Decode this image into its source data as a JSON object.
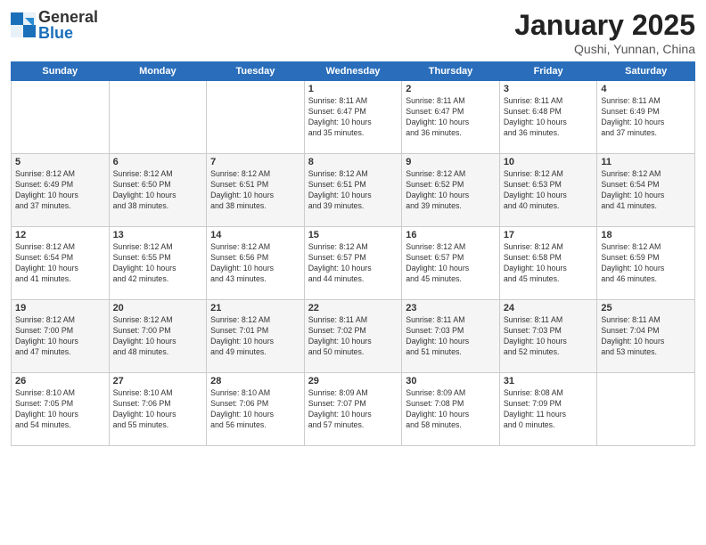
{
  "header": {
    "logo": {
      "general": "General",
      "blue": "Blue"
    },
    "title": "January 2025",
    "subtitle": "Qushi, Yunnan, China"
  },
  "days_of_week": [
    "Sunday",
    "Monday",
    "Tuesday",
    "Wednesday",
    "Thursday",
    "Friday",
    "Saturday"
  ],
  "weeks": [
    [
      {
        "day": "",
        "info": ""
      },
      {
        "day": "",
        "info": ""
      },
      {
        "day": "",
        "info": ""
      },
      {
        "day": "1",
        "info": "Sunrise: 8:11 AM\nSunset: 6:47 PM\nDaylight: 10 hours\nand 35 minutes."
      },
      {
        "day": "2",
        "info": "Sunrise: 8:11 AM\nSunset: 6:47 PM\nDaylight: 10 hours\nand 36 minutes."
      },
      {
        "day": "3",
        "info": "Sunrise: 8:11 AM\nSunset: 6:48 PM\nDaylight: 10 hours\nand 36 minutes."
      },
      {
        "day": "4",
        "info": "Sunrise: 8:11 AM\nSunset: 6:49 PM\nDaylight: 10 hours\nand 37 minutes."
      }
    ],
    [
      {
        "day": "5",
        "info": "Sunrise: 8:12 AM\nSunset: 6:49 PM\nDaylight: 10 hours\nand 37 minutes."
      },
      {
        "day": "6",
        "info": "Sunrise: 8:12 AM\nSunset: 6:50 PM\nDaylight: 10 hours\nand 38 minutes."
      },
      {
        "day": "7",
        "info": "Sunrise: 8:12 AM\nSunset: 6:51 PM\nDaylight: 10 hours\nand 38 minutes."
      },
      {
        "day": "8",
        "info": "Sunrise: 8:12 AM\nSunset: 6:51 PM\nDaylight: 10 hours\nand 39 minutes."
      },
      {
        "day": "9",
        "info": "Sunrise: 8:12 AM\nSunset: 6:52 PM\nDaylight: 10 hours\nand 39 minutes."
      },
      {
        "day": "10",
        "info": "Sunrise: 8:12 AM\nSunset: 6:53 PM\nDaylight: 10 hours\nand 40 minutes."
      },
      {
        "day": "11",
        "info": "Sunrise: 8:12 AM\nSunset: 6:54 PM\nDaylight: 10 hours\nand 41 minutes."
      }
    ],
    [
      {
        "day": "12",
        "info": "Sunrise: 8:12 AM\nSunset: 6:54 PM\nDaylight: 10 hours\nand 41 minutes."
      },
      {
        "day": "13",
        "info": "Sunrise: 8:12 AM\nSunset: 6:55 PM\nDaylight: 10 hours\nand 42 minutes."
      },
      {
        "day": "14",
        "info": "Sunrise: 8:12 AM\nSunset: 6:56 PM\nDaylight: 10 hours\nand 43 minutes."
      },
      {
        "day": "15",
        "info": "Sunrise: 8:12 AM\nSunset: 6:57 PM\nDaylight: 10 hours\nand 44 minutes."
      },
      {
        "day": "16",
        "info": "Sunrise: 8:12 AM\nSunset: 6:57 PM\nDaylight: 10 hours\nand 45 minutes."
      },
      {
        "day": "17",
        "info": "Sunrise: 8:12 AM\nSunset: 6:58 PM\nDaylight: 10 hours\nand 45 minutes."
      },
      {
        "day": "18",
        "info": "Sunrise: 8:12 AM\nSunset: 6:59 PM\nDaylight: 10 hours\nand 46 minutes."
      }
    ],
    [
      {
        "day": "19",
        "info": "Sunrise: 8:12 AM\nSunset: 7:00 PM\nDaylight: 10 hours\nand 47 minutes."
      },
      {
        "day": "20",
        "info": "Sunrise: 8:12 AM\nSunset: 7:00 PM\nDaylight: 10 hours\nand 48 minutes."
      },
      {
        "day": "21",
        "info": "Sunrise: 8:12 AM\nSunset: 7:01 PM\nDaylight: 10 hours\nand 49 minutes."
      },
      {
        "day": "22",
        "info": "Sunrise: 8:11 AM\nSunset: 7:02 PM\nDaylight: 10 hours\nand 50 minutes."
      },
      {
        "day": "23",
        "info": "Sunrise: 8:11 AM\nSunset: 7:03 PM\nDaylight: 10 hours\nand 51 minutes."
      },
      {
        "day": "24",
        "info": "Sunrise: 8:11 AM\nSunset: 7:03 PM\nDaylight: 10 hours\nand 52 minutes."
      },
      {
        "day": "25",
        "info": "Sunrise: 8:11 AM\nSunset: 7:04 PM\nDaylight: 10 hours\nand 53 minutes."
      }
    ],
    [
      {
        "day": "26",
        "info": "Sunrise: 8:10 AM\nSunset: 7:05 PM\nDaylight: 10 hours\nand 54 minutes."
      },
      {
        "day": "27",
        "info": "Sunrise: 8:10 AM\nSunset: 7:06 PM\nDaylight: 10 hours\nand 55 minutes."
      },
      {
        "day": "28",
        "info": "Sunrise: 8:10 AM\nSunset: 7:06 PM\nDaylight: 10 hours\nand 56 minutes."
      },
      {
        "day": "29",
        "info": "Sunrise: 8:09 AM\nSunset: 7:07 PM\nDaylight: 10 hours\nand 57 minutes."
      },
      {
        "day": "30",
        "info": "Sunrise: 8:09 AM\nSunset: 7:08 PM\nDaylight: 10 hours\nand 58 minutes."
      },
      {
        "day": "31",
        "info": "Sunrise: 8:08 AM\nSunset: 7:09 PM\nDaylight: 11 hours\nand 0 minutes."
      },
      {
        "day": "",
        "info": ""
      }
    ]
  ]
}
